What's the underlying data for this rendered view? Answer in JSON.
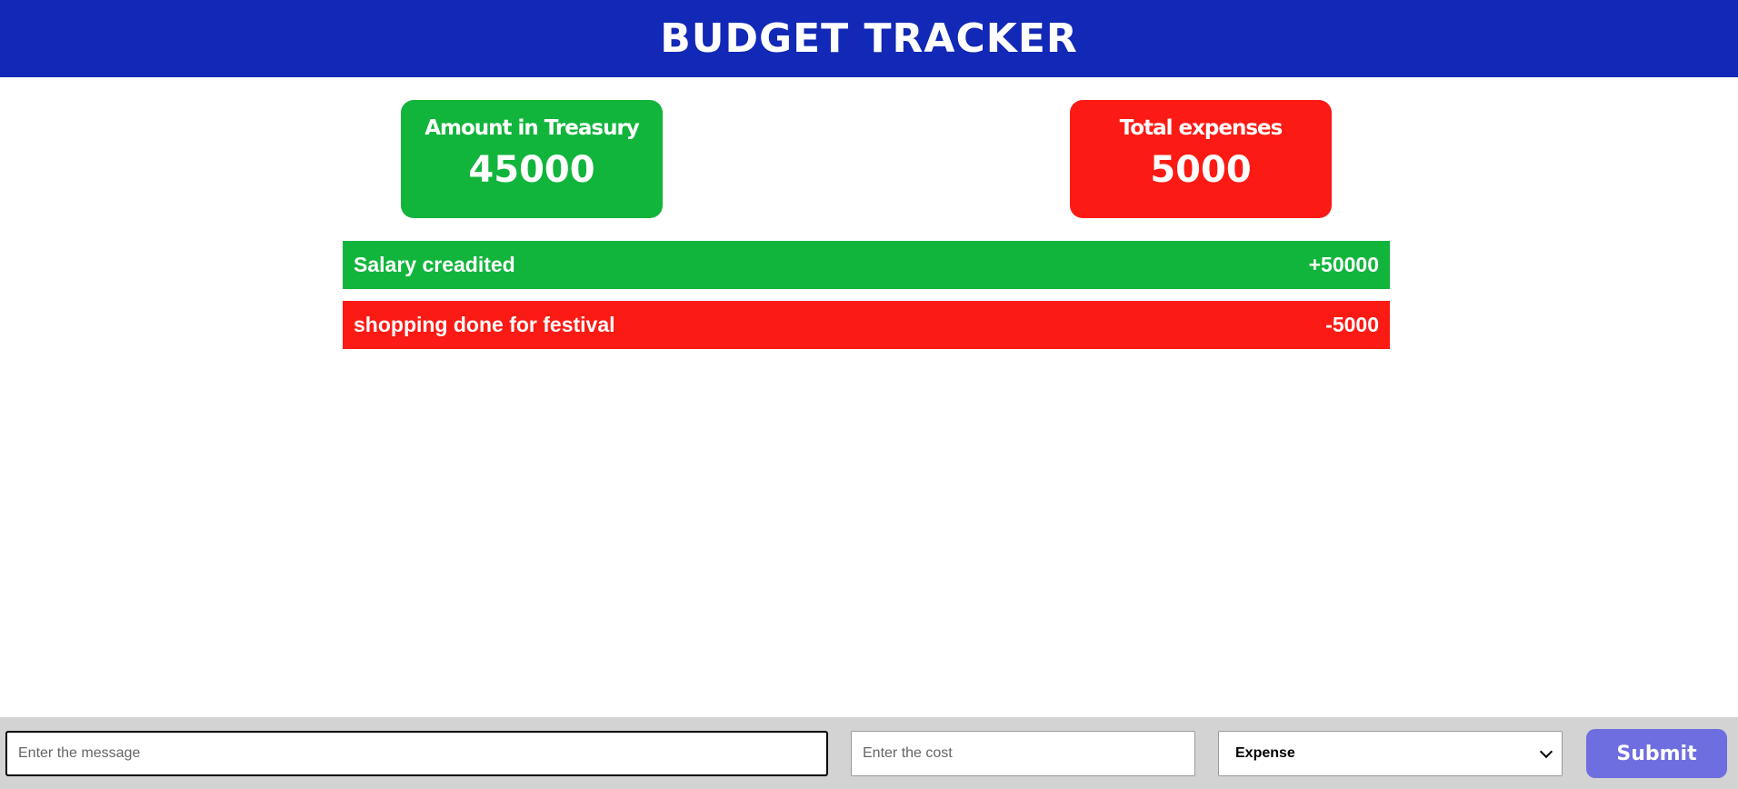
{
  "header": {
    "title": "BUDGET TRACKER"
  },
  "summary": {
    "treasury": {
      "label": "Amount in Treasury",
      "value": "45000",
      "color": "#12b53c"
    },
    "expenses": {
      "label": "Total expenses",
      "value": "5000",
      "color": "#fc1a14"
    }
  },
  "transactions": [
    {
      "description": "Salary creadited",
      "amount": "+50000",
      "type": "income",
      "color": "#12b53c"
    },
    {
      "description": "shopping done for festival",
      "amount": "-5000",
      "type": "expense",
      "color": "#fc1a14"
    }
  ],
  "form": {
    "message_placeholder": "Enter the message",
    "message_value": "",
    "cost_placeholder": "Enter the cost",
    "cost_value": "",
    "type_selected": "Expense",
    "submit_label": "Submit"
  },
  "colors": {
    "header": "#1228b6",
    "submit": "#6e6ee0",
    "footer": "#d3d3d3"
  }
}
